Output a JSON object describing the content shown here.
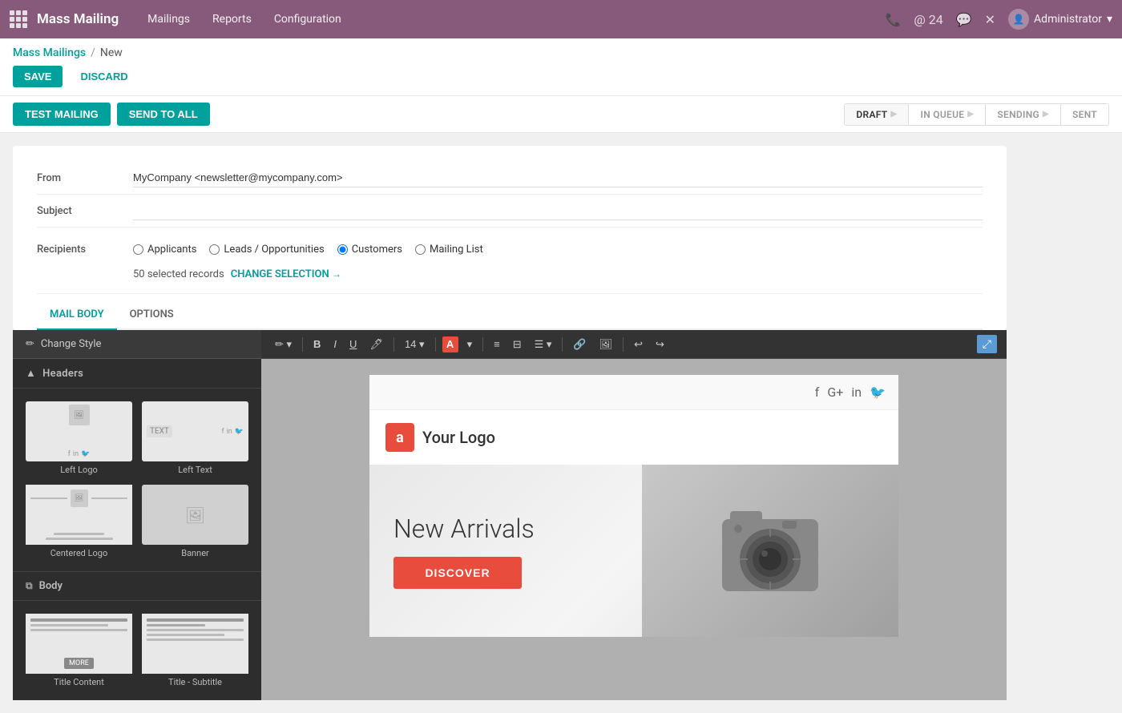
{
  "app": {
    "grid_icon": "grid-icon",
    "title": "Mass Mailing",
    "nav": {
      "items": [
        {
          "label": "Mailings",
          "id": "mailings"
        },
        {
          "label": "Reports",
          "id": "reports"
        },
        {
          "label": "Configuration",
          "id": "configuration"
        }
      ]
    },
    "top_right": {
      "phone_icon": "phone-icon",
      "at_badge": "@ 24",
      "chat_icon": "chat-icon",
      "tools_icon": "tools-icon",
      "user": "Administrator"
    }
  },
  "breadcrumb": {
    "parent": "Mass Mailings",
    "separator": "/",
    "current": "New"
  },
  "actions": {
    "save_label": "SAVE",
    "discard_label": "DISCARD",
    "test_mailing_label": "TEST MAILING",
    "send_to_all_label": "SEND TO ALL"
  },
  "status": {
    "items": [
      {
        "label": "DRAFT",
        "active": true
      },
      {
        "label": "IN QUEUE",
        "active": false
      },
      {
        "label": "SENDING",
        "active": false
      },
      {
        "label": "SENT",
        "active": false
      }
    ]
  },
  "form": {
    "from_label": "From",
    "from_value": "MyCompany <newsletter@mycompany.com>",
    "subject_label": "Subject",
    "subject_value": "",
    "recipients_label": "Recipients",
    "recipient_options": [
      {
        "label": "Applicants",
        "id": "applicants",
        "checked": false
      },
      {
        "label": "Leads / Opportunities",
        "id": "leads",
        "checked": false
      },
      {
        "label": "Customers",
        "id": "customers",
        "checked": true
      },
      {
        "label": "Mailing List",
        "id": "mailing_list",
        "checked": false
      }
    ],
    "selected_records": "50 selected records",
    "change_selection_label": "CHANGE SELECTION",
    "change_selection_arrow": "→"
  },
  "tabs": {
    "items": [
      {
        "label": "MAIL BODY",
        "id": "mail_body",
        "active": true
      },
      {
        "label": "OPTIONS",
        "id": "options",
        "active": false
      }
    ]
  },
  "editor": {
    "change_style_label": "Change Style",
    "pencil_icon": "pencil-icon",
    "headers_label": "Headers",
    "chevron_icon": "chevron-up-icon",
    "templates": {
      "headers": [
        {
          "id": "left-logo",
          "label": "Left Logo"
        },
        {
          "id": "left-text",
          "label": "Left Text"
        },
        {
          "id": "centered-logo",
          "label": "Centered Logo"
        },
        {
          "id": "banner",
          "label": "Banner"
        }
      ],
      "body": [
        {
          "id": "title-content",
          "label": "Title Content"
        },
        {
          "id": "title-subtitle",
          "label": "Title - Subtitle"
        }
      ]
    },
    "body_label": "Body",
    "toolbar": {
      "pen_icon": "pen-icon",
      "bold_label": "B",
      "italic_label": "I",
      "underline_label": "U",
      "highlight_icon": "highlight-icon",
      "font_size": "14",
      "font_color_label": "A",
      "dropdown_icon": "dropdown-icon",
      "list_icon": "list-icon",
      "ordered_list_icon": "ordered-list-icon",
      "align_icon": "align-icon",
      "link_icon": "link-icon",
      "image_icon": "image-icon",
      "undo_icon": "undo-icon",
      "redo_icon": "redo-icon",
      "expand_icon": "expand-icon"
    },
    "email_preview": {
      "social_icons": [
        "f",
        "G+",
        "in",
        "🐦"
      ],
      "logo_letter": "a",
      "logo_text": "Your Logo",
      "banner_title": "New Arrivals",
      "discover_btn": "DISCOVER"
    }
  }
}
